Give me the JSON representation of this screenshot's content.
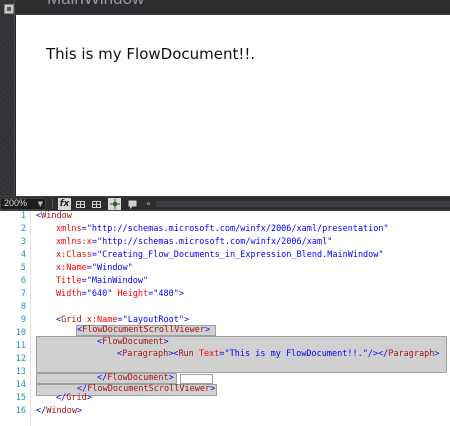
{
  "designer": {
    "window_title": "MainWindow",
    "flow_text": "This is my FlowDocument!!."
  },
  "toolbar": {
    "zoom": "200%",
    "zoom_arrow": "▼",
    "collapse": "«"
  },
  "editor": {
    "line_numbers": [
      "1",
      "2",
      "3",
      "4",
      "5",
      "6",
      "7",
      "8",
      "9",
      "10",
      "11",
      "12",
      "13",
      "14",
      "15",
      "16"
    ],
    "l1": {
      "br_open": "<",
      "tag": "Window"
    },
    "l2": {
      "attr": "xmlns",
      "eq": "=",
      "val": "\"http://schemas.microsoft.com/winfx/2006/xaml/presentation\""
    },
    "l3": {
      "attr": "xmlns:x",
      "eq": "=",
      "val": "\"http://schemas.microsoft.com/winfx/2006/xaml\""
    },
    "l4": {
      "attr": "x:Class",
      "eq": "=",
      "val": "\"Creating_Flow_Documents_in_Expression_Blend.MainWindow\""
    },
    "l5": {
      "attr": "x:Name",
      "eq": "=",
      "val": "\"Window\""
    },
    "l6": {
      "attr": "Title",
      "eq": "=",
      "val": "\"MainWindow\""
    },
    "l7": {
      "attr1": "Width",
      "eq": "=",
      "val1": "\"640\"",
      "attr2": "Height",
      "val2": "\"480\"",
      "close": ">"
    },
    "l9": {
      "br_open": "<",
      "tag": "Grid",
      "attr": "x:Name",
      "eq": "=",
      "val": "\"LayoutRoot\"",
      "close": ">"
    },
    "l10": {
      "br_open": "<",
      "tag": "FlowDocumentScrollViewer",
      "close": ">"
    },
    "l11": {
      "br_open": "<",
      "tag": "FlowDocument",
      "close": ">"
    },
    "l12": {
      "br_open": "<",
      "tag1": "Paragraph",
      "close1": "><",
      "tag2": "Run",
      "attr": "Text",
      "eq": "=",
      "val": "\"This is my FlowDocument!!.\"",
      "selfclose": "/></",
      "tag3": "Paragraph",
      "close2": ">"
    },
    "l13": {
      "br_open": "</",
      "tag": "FlowDocument",
      "close": ">"
    },
    "l14": {
      "br_open": "</",
      "tag": "FlowDocumentScrollViewer",
      "close": ">"
    },
    "l15": {
      "br_open": "</",
      "tag": "Grid",
      "close": ">"
    },
    "l16": {
      "br_open": "</",
      "tag": "Window",
      "close": ">"
    }
  },
  "colors": {
    "tag": "#a31515",
    "attribute": "#ff0000",
    "value": "#0000ff",
    "line_number": "#2b91af",
    "highlight": "#d0d0d0"
  }
}
